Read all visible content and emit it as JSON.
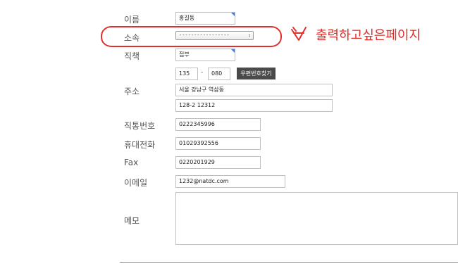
{
  "form": {
    "name": {
      "label": "이름",
      "value": "홍길동"
    },
    "affiliation": {
      "label": "소속",
      "value": "-----------------"
    },
    "position": {
      "label": "직책",
      "value": "접부"
    },
    "address": {
      "label": "주소",
      "zip1": "135",
      "zip_sep": "-",
      "zip2": "080",
      "zip_button": "우편번호찾기",
      "line1": "서울 강남구 역삼동",
      "line2": "128-2 12312"
    },
    "direct_phone": {
      "label": "직통번호",
      "value": "0222345996"
    },
    "mobile": {
      "label": "휴대전화",
      "value": "01029392556"
    },
    "fax": {
      "label": "Fax",
      "value": "0220201929"
    },
    "email": {
      "label": "이메일",
      "value": "1232@natdc.com"
    },
    "memo": {
      "label": "메모",
      "value": ""
    }
  },
  "annotation": {
    "text": "출력하고싶은페이지",
    "color": "#e0302c"
  }
}
